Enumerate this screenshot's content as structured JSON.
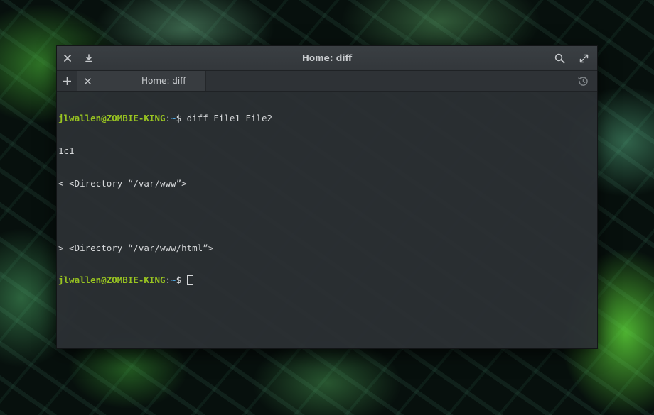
{
  "window": {
    "title": "Home: diff"
  },
  "titlebar_icons": {
    "close": "close-icon",
    "download": "download-icon",
    "search": "search-icon",
    "fullscreen": "fullscreen-icon"
  },
  "tabs": [
    {
      "label": "Home: diff",
      "active": true
    }
  ],
  "terminal": {
    "prompt_user": "jlwallen@ZOMBIE-KING",
    "prompt_sep": ":",
    "prompt_path": "~",
    "prompt_symbol": "$",
    "command": "diff File1 File2",
    "output": [
      "1c1",
      "< <Directory “/var/www”>",
      "---",
      "> <Directory “/var/www/html”>"
    ]
  },
  "colors": {
    "prompt_user": "#99c421",
    "prompt_path": "#4fa7e0",
    "terminal_text": "#d6d8da",
    "terminal_bg": "#2c3034"
  }
}
